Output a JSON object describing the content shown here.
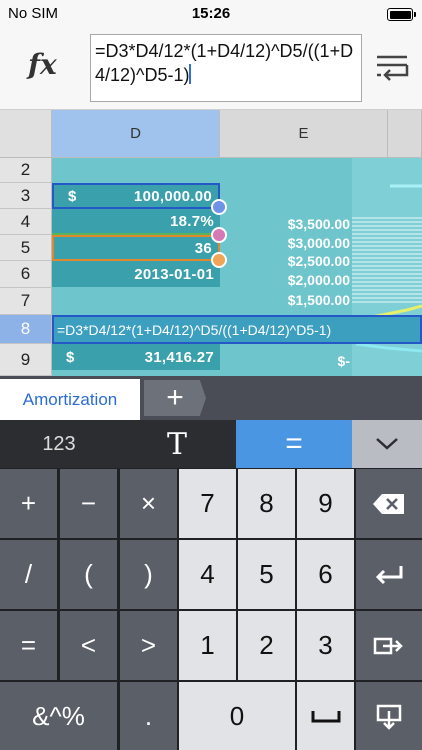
{
  "status": {
    "carrier": "No SIM",
    "time": "15:26"
  },
  "formula": {
    "fx": "fx",
    "text": "=D3*D4/12*(1+D4/12)^D5/((1+D4/12)^D5-1)"
  },
  "columns": [
    "D",
    "E"
  ],
  "rows": [
    "2",
    "3",
    "4",
    "5",
    "6",
    "7",
    "8",
    "9"
  ],
  "cells": {
    "d3_currency": "$",
    "d3": "100,000.00",
    "d4": "18.7%",
    "d5": "36",
    "d6": "2013-01-01",
    "d8_formula": "=D3*D4/12*(1+D4/12)^D5/((1+D4/12)^D5-1)",
    "d9_currency": "$",
    "d9": "31,416.27"
  },
  "chart_data": {
    "type": "line",
    "yticks": [
      "$3,500.00",
      "$3,000.00",
      "$2,500.00",
      "$2,000.00",
      "$1,500.00",
      "$-"
    ],
    "colors": {
      "line1": "#e6f06a",
      "line2": "#8de8f0"
    }
  },
  "tabs": {
    "sheet": "Amortization",
    "add": "+"
  },
  "keyboard": {
    "top": {
      "numbers": "123",
      "text": "T",
      "formula": "="
    },
    "rows": [
      [
        "+",
        "−",
        "×",
        "7",
        "8",
        "9"
      ],
      [
        "/",
        "(",
        ")",
        "4",
        "5",
        "6"
      ],
      [
        "=",
        "<",
        ">",
        "1",
        "2",
        "3"
      ],
      [
        "&^%",
        ".",
        "0"
      ]
    ],
    "icons": [
      "backspace-icon",
      "return-icon",
      "tab-right-icon",
      "space-icon",
      "commit-down-icon",
      "chevron-down-icon"
    ]
  }
}
